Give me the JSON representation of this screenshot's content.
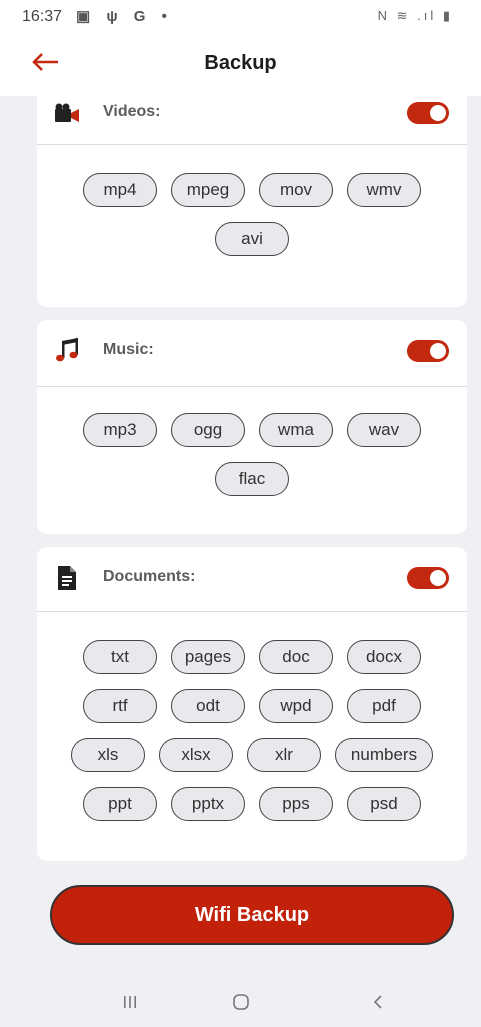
{
  "status_bar": {
    "time": "16:37",
    "left_icons": "▣ ψ G •",
    "right_icons": "N ≋ .ıl ▮"
  },
  "header": {
    "title": "Backup"
  },
  "colors": {
    "accent": "#c2290f",
    "card_bg": "#ffffff",
    "page_bg": "#eef0f4",
    "chip_bg": "#e8e9ec"
  },
  "sections": {
    "videos": {
      "title": "Videos:",
      "icon": "video-camera-icon",
      "enabled": true,
      "formats": [
        "mp4",
        "mpeg",
        "mov",
        "wmv",
        "avi"
      ]
    },
    "music": {
      "title": "Music:",
      "icon": "music-note-icon",
      "enabled": true,
      "formats": [
        "mp3",
        "ogg",
        "wma",
        "wav",
        "flac"
      ]
    },
    "documents": {
      "title": "Documents:",
      "icon": "document-icon",
      "enabled": true,
      "formats": [
        "txt",
        "pages",
        "doc",
        "docx",
        "rtf",
        "odt",
        "wpd",
        "pdf",
        "xls",
        "xlsx",
        "xlr",
        "numbers",
        "ppt",
        "pptx",
        "pps",
        "psd"
      ]
    }
  },
  "actions": {
    "wifi_backup_label": "Wifi Backup"
  },
  "nav_bar": {
    "recents": "recent-apps-icon",
    "home": "home-icon",
    "back": "back-icon"
  }
}
